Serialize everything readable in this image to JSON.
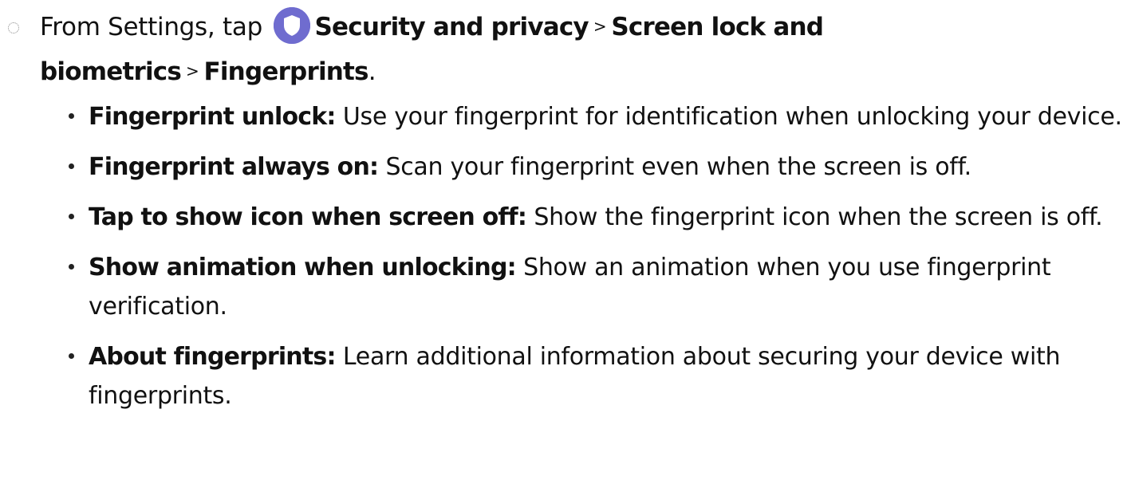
{
  "step": {
    "prefix": "From Settings, tap",
    "icon": "shield-icon",
    "icon_color": "#6f6ccf",
    "path_1": "Security and privacy",
    "separator_1": ">",
    "path_2": "Screen lock and biometrics",
    "separator_2": ">",
    "path_3": "Fingerprints",
    "end": "."
  },
  "bullets": [
    {
      "term": "Fingerprint unlock",
      "colon": ":",
      "desc": "Use your fingerprint for identification when unlocking your device."
    },
    {
      "term": "Fingerprint always on",
      "colon": ":",
      "desc": "Scan your fingerprint even when the screen is off."
    },
    {
      "term": "Tap to show icon when screen off",
      "colon": ":",
      "desc": "Show the fingerprint icon when the screen is off."
    },
    {
      "term": "Show animation when unlocking",
      "colon": ":",
      "desc": "Show an animation when you use fingerprint verification."
    },
    {
      "term": "About fingerprints",
      "colon": ":",
      "desc": "Learn additional information about securing your device with fingerprints."
    }
  ]
}
